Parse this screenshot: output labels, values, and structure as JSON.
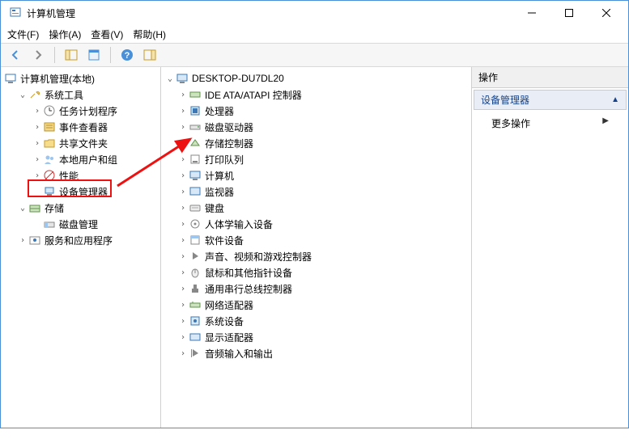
{
  "window": {
    "title": "计算机管理"
  },
  "menu": {
    "file": "文件(F)",
    "action": "操作(A)",
    "view": "查看(V)",
    "help": "帮助(H)"
  },
  "right": {
    "header": "操作",
    "section": "设备管理器",
    "more": "更多操作"
  },
  "left": {
    "root": "计算机管理(本地)",
    "system_tools": "系统工具",
    "task_scheduler": "任务计划程序",
    "event_viewer": "事件查看器",
    "shared_folders": "共享文件夹",
    "local_users": "本地用户和组",
    "performance": "性能",
    "device_manager": "设备管理器",
    "storage": "存储",
    "disk_mgmt": "磁盘管理",
    "services": "服务和应用程序"
  },
  "mid": {
    "root": "DESKTOP-DU7DL20",
    "items": [
      "IDE ATA/ATAPI 控制器",
      "处理器",
      "磁盘驱动器",
      "存储控制器",
      "打印队列",
      "计算机",
      "监视器",
      "键盘",
      "人体学输入设备",
      "软件设备",
      "声音、视频和游戏控制器",
      "鼠标和其他指针设备",
      "通用串行总线控制器",
      "网络适配器",
      "系统设备",
      "显示适配器",
      "音频输入和输出"
    ]
  }
}
